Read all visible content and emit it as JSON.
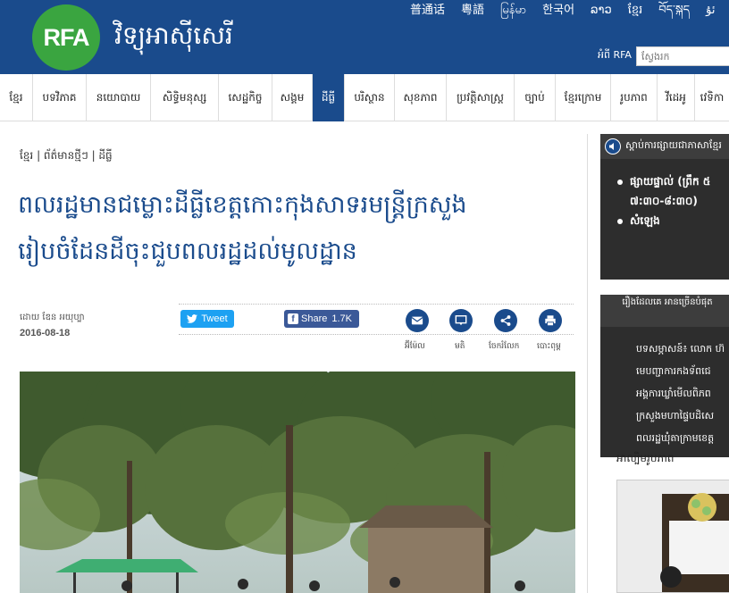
{
  "site": {
    "logo_text": "RFA",
    "name": "វិទ្យុអាស៊ីសេរី",
    "about_label": "អំពី RFA",
    "search_placeholder": "ស្វែងរក"
  },
  "languages": [
    "普通话",
    "粵語",
    "မြန်မာ",
    "한국어",
    "ລາວ",
    "ខ្មែរ",
    "བོད་སྐད",
    "ئۇ"
  ],
  "nav": {
    "items": [
      "ខ្មែរ",
      "បទវិភាគ",
      "នយោបាយ",
      "សិទ្ធិមនុស្ស",
      "សេដ្ឋកិច្ច",
      "សង្គម",
      "ដីធ្លី",
      "បរិស្ថាន",
      "សុខភាព",
      "ប្រវត្តិសាស្ត្រ",
      "ច្បាប់",
      "ខ្មែរក្រោម",
      "រូបភាព",
      "វីដេអូ",
      "វេទិកា"
    ],
    "active": "ដីធ្លី"
  },
  "article": {
    "breadcrumb": [
      "ខ្មែរ",
      "ព័ត៌មានថ្មីៗ",
      "ដីធ្លី"
    ],
    "headline_line1": "ពលរដ្ឋមានជម្លោះដីធ្លីខេត្តកោះកុងសាទរមន្ត្រីក្រសួង",
    "headline_line2": "រៀបចំដែនដីចុះជួបពលរដ្ឋដល់មូលដ្ឋាន",
    "byline": "ដោយ ឌែន អយុប្បា",
    "date": "2016-08-18",
    "tweet_label": "Tweet",
    "share_label": "Share",
    "share_count": "1.7K",
    "tools": {
      "email": "អ៊ីម៉ែល",
      "comment": "មតិ",
      "share": "ចែករំលែក",
      "print": "បោះពុម្ព"
    }
  },
  "sidebar": {
    "listen_title": "ស្ដាប់ការផ្សាយជាភាសាខ្មែរ",
    "listen_items": [
      "ផ្សាយផ្ទាល់ (ព្រឹក ៥",
      "៧:៣០-៨:៣០)",
      "សំឡេង"
    ],
    "popular_title": "រឿងដែលគេ អានច្រើនបំផុត",
    "popular_items": [
      "បទសម្ភាសន៍៖ លោក ហ៊",
      "មេបញ្ជាការកងទ័ពជេ",
      "អង្គការឃ្លាំមើលពិភព",
      "ក្រសួងមហាផ្ទៃបដិសេ",
      "ពលរដ្ឋឃុំតាក្រាមខេត្ត"
    ],
    "gallery_title": "អាល្បិមរូបភាព"
  }
}
